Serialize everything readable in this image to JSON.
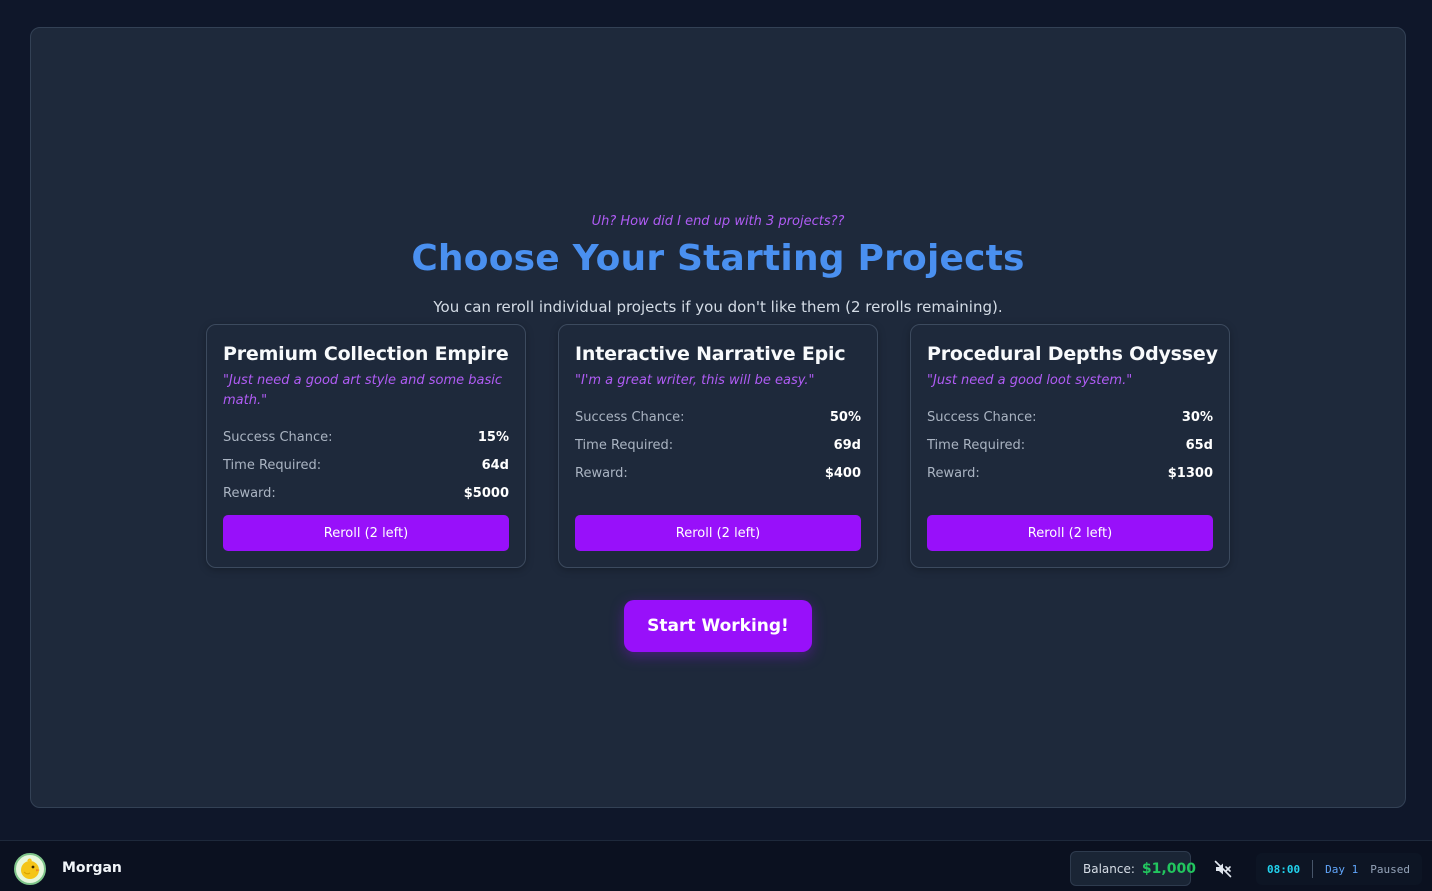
{
  "intro": "Uh? How did I end up with 3 projects??",
  "title": "Choose Your Starting Projects",
  "subtitle": "You can reroll individual projects if you don't like them (2 rerolls remaining).",
  "labels": {
    "success": "Success Chance:",
    "time": "Time Required:",
    "reward": "Reward:"
  },
  "projects": [
    {
      "name": "Premium Collection Empire",
      "quote": "\"Just need a good art style and some basic math.\"",
      "success": "15%",
      "time": "64d",
      "reward": "$5000",
      "reroll_label": "Reroll (2 left)"
    },
    {
      "name": "Interactive Narrative Epic",
      "quote": "\"I'm a great writer, this will be easy.\"",
      "success": "50%",
      "time": "69d",
      "reward": "$400",
      "reroll_label": "Reroll (2 left)"
    },
    {
      "name": "Procedural Depths Odyssey",
      "quote": "\"Just need a good loot system.\"",
      "success": "30%",
      "time": "65d",
      "reward": "$1300",
      "reroll_label": "Reroll (2 left)"
    }
  ],
  "start_label": "Start Working!",
  "footer": {
    "username": "Morgan",
    "balance_label": "Balance:",
    "balance_value": "$1,000",
    "mute_icon": "speaker-muted-icon",
    "time": "08:00",
    "day": "Day 1",
    "status": "Paused"
  },
  "colors": {
    "accent_purple": "#9810fa",
    "title_blue": "#4a90f0",
    "quote_purple": "#b05cf5",
    "balance_green": "#22c55e",
    "clock_cyan": "#22d3ee"
  }
}
